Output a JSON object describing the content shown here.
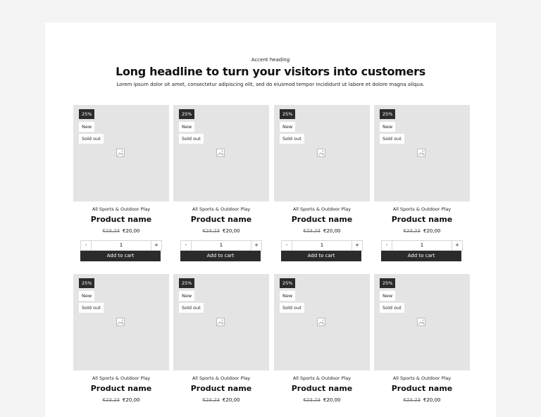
{
  "hero": {
    "accent": "Accent heading",
    "headline": "Long headline to turn your visitors into customers",
    "subtext": "Lorem ipsum dolor sit amet, consectetur adipiscing elit, sed do eiusmod tempor incididunt ut labore et dolore magna aliqua."
  },
  "products": [
    {
      "discount": "25%",
      "new": "New",
      "sold_out": "Sold out",
      "category": "All Sports & Outdoor Play",
      "name": "Product name",
      "old_price": "€23,23",
      "price": "€20,00",
      "qty": "1",
      "minus": "-",
      "plus": "+",
      "add": "Add to cart"
    },
    {
      "discount": "25%",
      "new": "New",
      "sold_out": "Sold out",
      "category": "All Sports & Outdoor Play",
      "name": "Product name",
      "old_price": "€23,23",
      "price": "€20,00",
      "qty": "1",
      "minus": "-",
      "plus": "+",
      "add": "Add to cart"
    },
    {
      "discount": "25%",
      "new": "New",
      "sold_out": "Sold out",
      "category": "All Sports & Outdoor Play",
      "name": "Product name",
      "old_price": "€23,23",
      "price": "€20,00",
      "qty": "1",
      "minus": "-",
      "plus": "+",
      "add": "Add to cart"
    },
    {
      "discount": "25%",
      "new": "New",
      "sold_out": "Sold out",
      "category": "All Sports & Outdoor Play",
      "name": "Product name",
      "old_price": "€23,23",
      "price": "€20,00",
      "qty": "1",
      "minus": "-",
      "plus": "+",
      "add": "Add to cart"
    },
    {
      "discount": "25%",
      "new": "New",
      "sold_out": "Sold out",
      "category": "All Sports & Outdoor Play",
      "name": "Product name",
      "old_price": "€23,23",
      "price": "€20,00"
    },
    {
      "discount": "25%",
      "new": "New",
      "sold_out": "Sold out",
      "category": "All Sports & Outdoor Play",
      "name": "Product name",
      "old_price": "€23,23",
      "price": "€20,00"
    },
    {
      "discount": "25%",
      "new": "New",
      "sold_out": "Sold out",
      "category": "All Sports & Outdoor Play",
      "name": "Product name",
      "old_price": "€23,23",
      "price": "€20,00"
    },
    {
      "discount": "25%",
      "new": "New",
      "sold_out": "Sold out",
      "category": "All Sports & Outdoor Play",
      "name": "Product name",
      "old_price": "€23,23",
      "price": "€20,00"
    }
  ]
}
